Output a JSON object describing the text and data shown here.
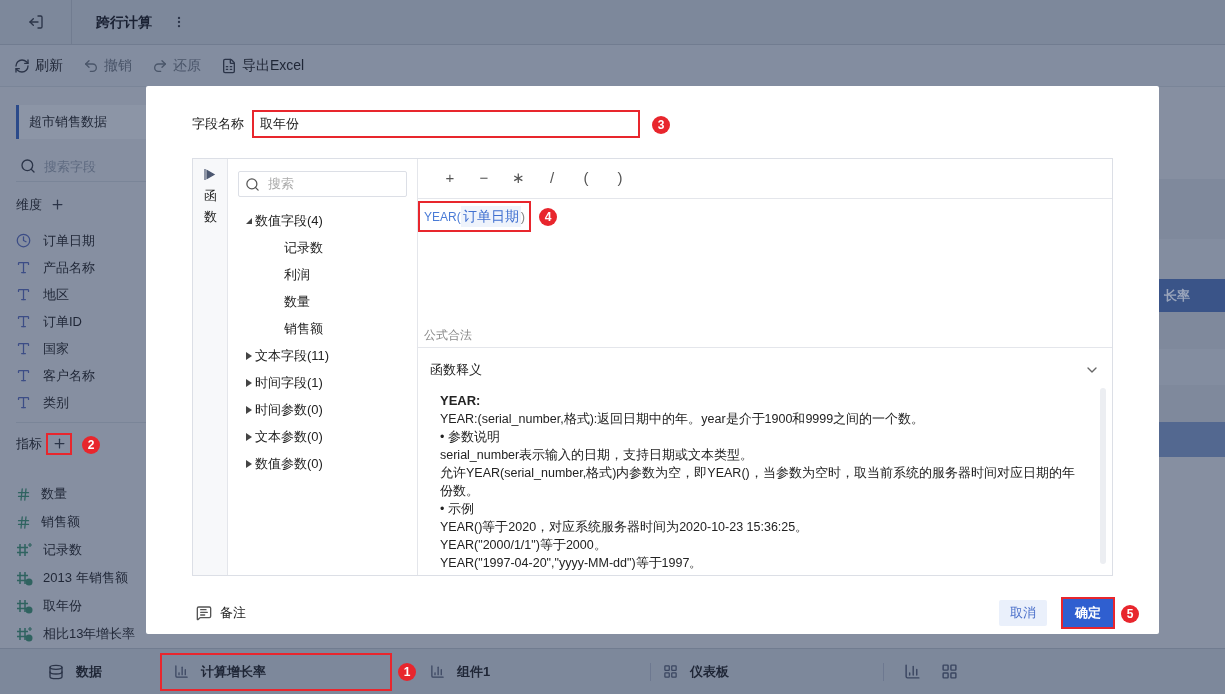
{
  "header": {
    "title": "跨行计算"
  },
  "toolbar": [
    {
      "label": "刷新",
      "disabled": false,
      "kind": "refresh"
    },
    {
      "label": "撤销",
      "disabled": true,
      "kind": "undo"
    },
    {
      "label": "还原",
      "disabled": true,
      "kind": "redo"
    },
    {
      "label": "导出Excel",
      "disabled": false,
      "kind": "excel"
    }
  ],
  "sidebar": {
    "dataset": "超市销售数据",
    "search": {
      "placeholder": "搜索字段"
    },
    "dimensions": {
      "title": "维度",
      "items": [
        {
          "label": "订单日期",
          "kind": "date"
        },
        {
          "label": "产品名称",
          "kind": "text"
        },
        {
          "label": "地区",
          "kind": "text"
        },
        {
          "label": "订单ID",
          "kind": "text"
        },
        {
          "label": "国家",
          "kind": "text"
        },
        {
          "label": "客户名称",
          "kind": "text"
        },
        {
          "label": "类别",
          "kind": "text"
        }
      ]
    },
    "measures": {
      "title": "指标",
      "add_highlighted": true,
      "marker": "2",
      "items": [
        {
          "label": "数量",
          "kind": "number"
        },
        {
          "label": "销售额",
          "kind": "number"
        },
        {
          "label": "记录数",
          "kind": "count"
        },
        {
          "label": "2013 年销售额",
          "kind": "calc"
        },
        {
          "label": "取年份",
          "kind": "calc"
        },
        {
          "label": "相比13年增长率",
          "kind": "calc_count"
        }
      ]
    }
  },
  "background_table": {
    "header_fragment": "长率"
  },
  "dialog": {
    "field_name": {
      "label": "字段名称",
      "value": "取年份",
      "highlighted": true,
      "marker": "3"
    },
    "side_tab": {
      "label": "函数"
    },
    "field_search": {
      "placeholder": "搜索"
    },
    "field_tree": [
      {
        "label": "数值字段(4)",
        "expanded": true,
        "children": [
          {
            "label": "记录数"
          },
          {
            "label": "利润"
          },
          {
            "label": "数量"
          },
          {
            "label": "销售额"
          }
        ]
      },
      {
        "label": "文本字段(11)",
        "expanded": false
      },
      {
        "label": "时间字段(1)",
        "expanded": false
      },
      {
        "label": "时间参数(0)",
        "expanded": false
      },
      {
        "label": "文本参数(0)",
        "expanded": false
      },
      {
        "label": "数值参数(0)",
        "expanded": false
      }
    ],
    "operators": [
      "+",
      "−",
      "∗",
      "/",
      "(",
      ")"
    ],
    "formula": {
      "function": "YEAR(",
      "field": "订单日期",
      "close": ")",
      "highlighted": true,
      "marker": "4"
    },
    "status": "公式合法",
    "explanation": {
      "title": "函数释义",
      "expanded": true,
      "heading": "YEAR:",
      "lines": [
        "YEAR:(serial_number,格式):返回日期中的年。year是介于1900和9999之间的一个数。",
        "•  参数说明",
        "serial_number表示输入的日期，支持日期或文本类型。",
        "允许YEAR(serial_number,格式)内参数为空，即YEAR()，当参数为空时，取当前系统的服务器时间对应日期的年份数。",
        "•  示例",
        "YEAR()等于2020，对应系统服务器时间为2020-10-23 15:36:25。",
        "YEAR(\"2000/1/1\")等于2000。",
        "YEAR(\"1997-04-20\",\"yyyy-MM-dd\")等于1997。"
      ]
    },
    "note": "备注",
    "cancel": "取消",
    "confirm": {
      "label": "确定",
      "highlighted": true,
      "marker": "5"
    }
  },
  "bottom_tabs": [
    {
      "label": "数据",
      "kind": "data",
      "highlighted": false
    },
    {
      "label": "计算增长率",
      "kind": "component",
      "highlighted": true,
      "marker": "1"
    },
    {
      "label": "组件1",
      "kind": "component",
      "highlighted": false
    },
    {
      "label": "仪表板",
      "kind": "dashboard",
      "highlighted": false
    }
  ]
}
